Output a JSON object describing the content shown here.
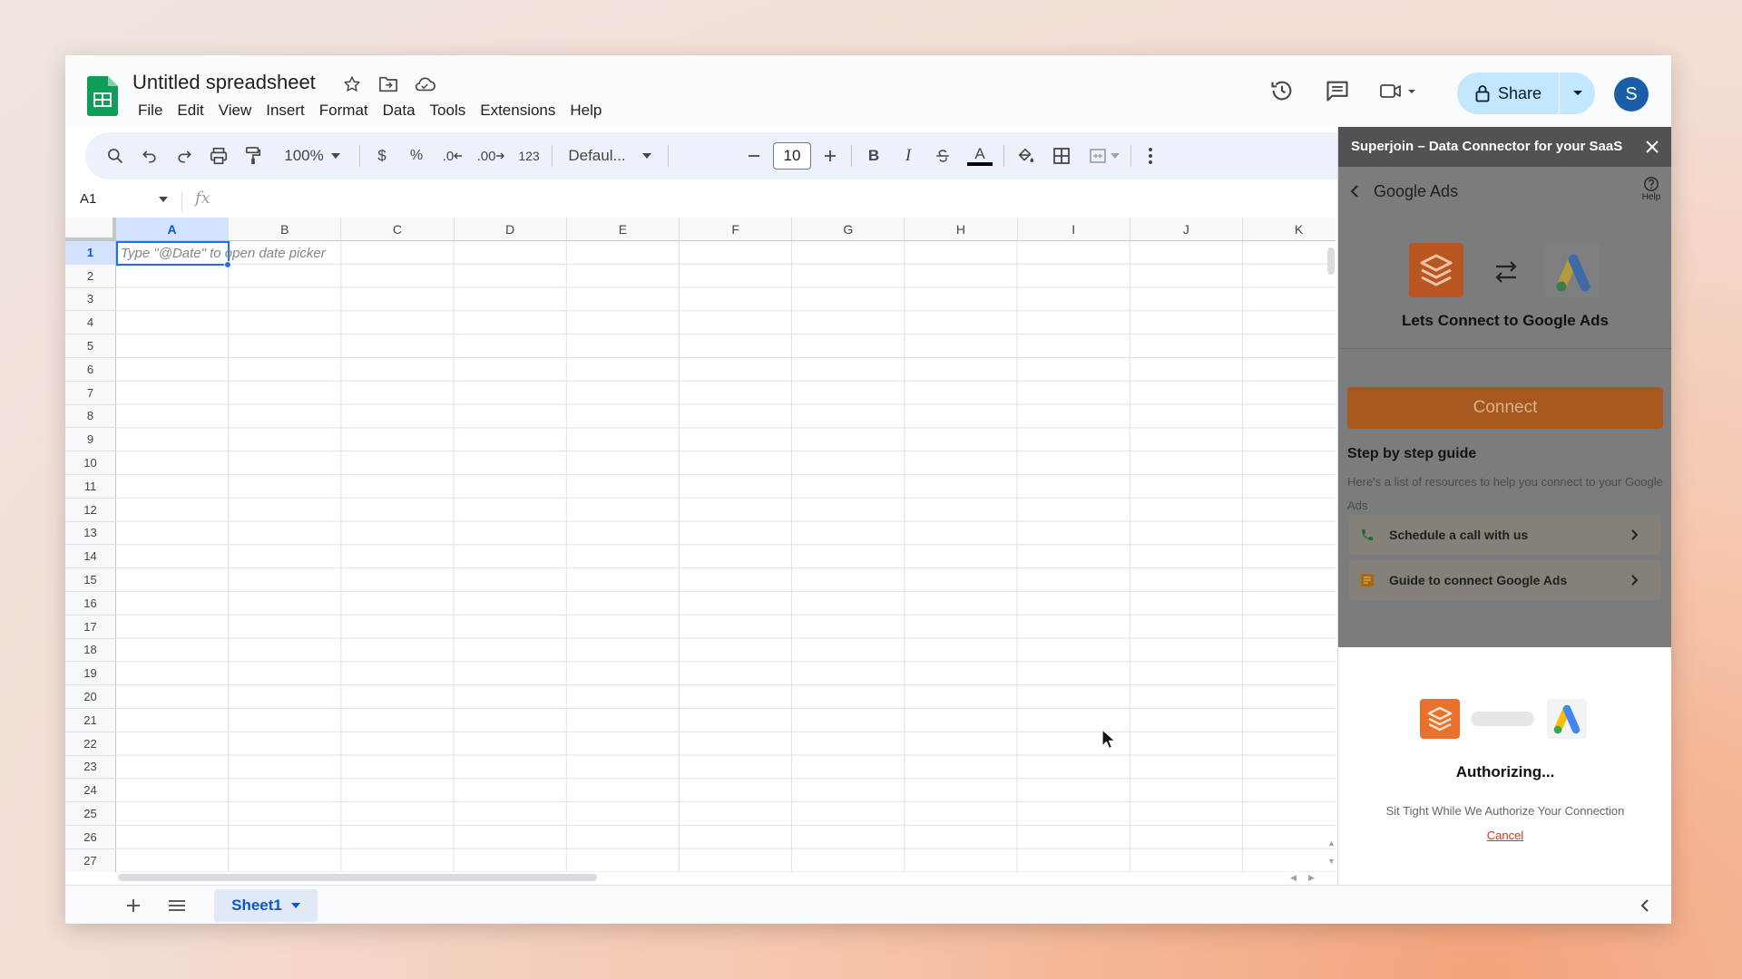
{
  "header": {
    "title": "Untitled spreadsheet",
    "menu": [
      "File",
      "Edit",
      "View",
      "Insert",
      "Format",
      "Data",
      "Tools",
      "Extensions",
      "Help"
    ],
    "share_label": "Share",
    "avatar_initial": "S"
  },
  "toolbar": {
    "zoom": "100%",
    "currency": "$",
    "percent": "%",
    "decrease_decimal": ".0",
    "increase_decimal": ".00",
    "number_format": "123",
    "font": "Defaul...",
    "font_size": "10",
    "bold": "B",
    "italic": "I",
    "text_color": "A"
  },
  "formula_bar": {
    "name_box": "A1",
    "fx": "fx"
  },
  "grid": {
    "columns": [
      "A",
      "B",
      "C",
      "D",
      "E",
      "F",
      "G",
      "H",
      "I",
      "J",
      "K"
    ],
    "rows": [
      "1",
      "2",
      "3",
      "4",
      "5",
      "6",
      "7",
      "8",
      "9",
      "10",
      "11",
      "12",
      "13",
      "14",
      "15",
      "16",
      "17",
      "18",
      "19",
      "20",
      "21",
      "22",
      "23",
      "24",
      "25",
      "26",
      "27"
    ],
    "selected_col": "A",
    "selected_row": "1",
    "cell_hint": "Type \"@Date\" to open date picker"
  },
  "sheets": {
    "active": "Sheet1"
  },
  "panel": {
    "title": "Superjoin – Data Connector for your SaaS",
    "nav_title": "Google Ads",
    "help_label": "Help",
    "connect_heading": "Lets Connect to Google Ads",
    "connect_button": "Connect",
    "guide_title": "Step by step guide",
    "guide_subtitle": "Here's a list of resources to help you connect to your Google Ads",
    "guide_items": [
      {
        "label": "Schedule a call with us",
        "icon": "phone-icon"
      },
      {
        "label": "Guide to connect Google Ads",
        "icon": "document-icon"
      }
    ],
    "auth_title": "Authorizing...",
    "auth_subtitle": "Sit Tight While We Authorize Your Connection",
    "auth_cancel": "Cancel"
  },
  "colors": {
    "sheets_green": "#0f9d58",
    "share_bg": "#c2e7ff",
    "avatar_bg": "#1a5ea8",
    "superjoin_orange": "#e8712b",
    "connect_button_dimmed": "#a8581e",
    "selection_blue": "#1a73e8"
  }
}
